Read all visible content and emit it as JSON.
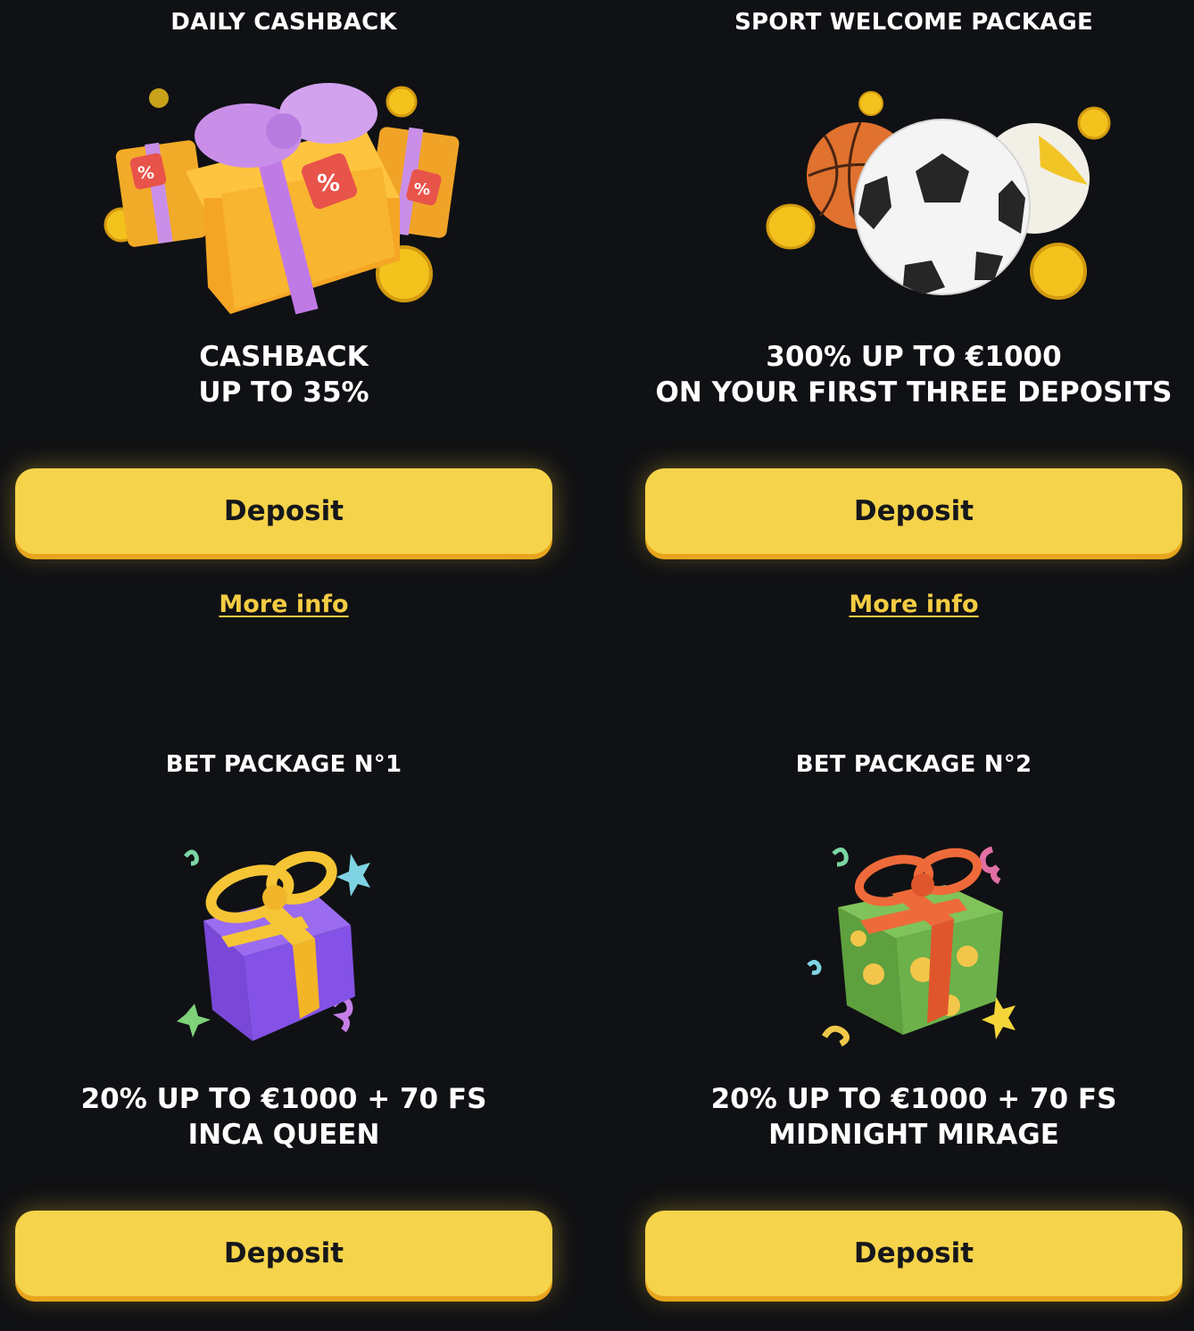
{
  "colors": {
    "background": "#101114",
    "button": "#f5d34a",
    "button_shadow": "#e7a51d",
    "link": "#f4cc43"
  },
  "cards": [
    {
      "title": "DAILY CASHBACK",
      "image_icon": "gift-boxes-with-coins-icon",
      "offer_line1": "CASHBACK",
      "offer_line2": "UP TO 35%",
      "button_label": "Deposit",
      "link_label": "More info"
    },
    {
      "title": "SPORT WELCOME PACKAGE",
      "image_icon": "sport-balls-with-coins-icon",
      "offer_line1": "300% UP TO €1000",
      "offer_line2": "ON YOUR FIRST THREE DEPOSITS",
      "button_label": "Deposit",
      "link_label": "More info"
    },
    {
      "title": "BET PACKAGE N°1",
      "image_icon": "purple-gift-box-icon",
      "offer_line1": "20% UP TO €1000 + 70 FS",
      "offer_line2": "INCA QUEEN",
      "button_label": "Deposit"
    },
    {
      "title": "BET PACKAGE N°2",
      "image_icon": "green-gift-box-icon",
      "offer_line1": "20% UP TO €1000 + 70 FS",
      "offer_line2": "MIDNIGHT MIRAGE",
      "button_label": "Deposit"
    }
  ]
}
